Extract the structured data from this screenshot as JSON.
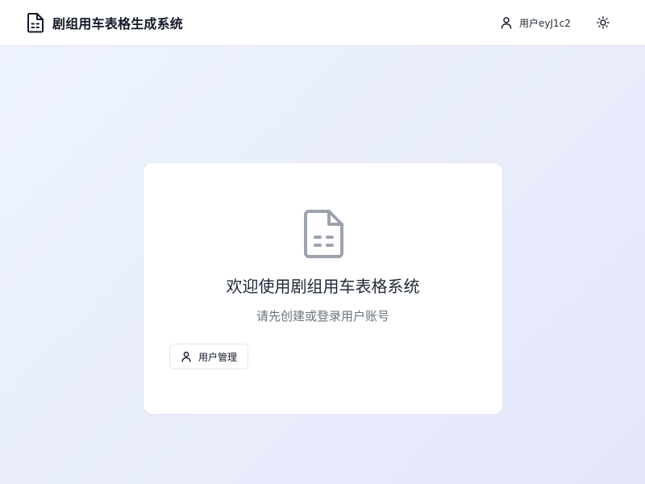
{
  "header": {
    "app_title": "剧组用车表格生成系统",
    "app_icon": "file-spreadsheet-icon",
    "user_label": "用户eyJ1c2",
    "user_icon": "user-icon",
    "theme_icon": "sun-icon"
  },
  "main": {
    "empty_state_icon": "file-spreadsheet-icon",
    "welcome_title": "欢迎使用剧组用车表格系统",
    "subtitle": "请先创建或登录用户账号",
    "user_management_button": "用户管理",
    "user_management_icon": "user-icon"
  },
  "colors": {
    "text_primary": "#111827",
    "text_secondary": "#6b7280",
    "icon_gray": "#9ca3af",
    "border": "#e5e7eb"
  }
}
